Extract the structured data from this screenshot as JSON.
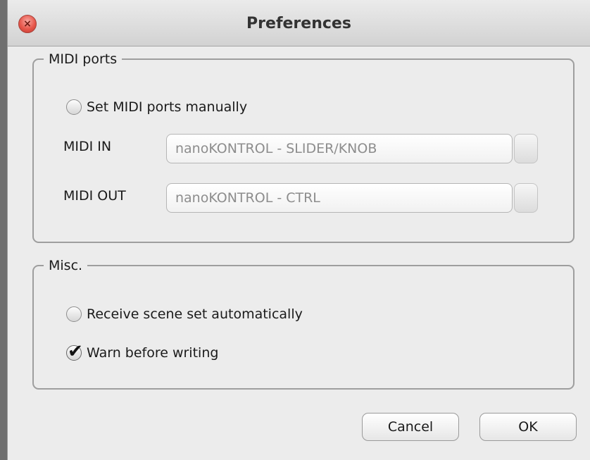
{
  "window": {
    "title": "Preferences",
    "close_icon_glyph": "×"
  },
  "midi_ports": {
    "legend": "MIDI ports",
    "manual_checkbox": {
      "label": "Set MIDI ports manually",
      "checked": false
    },
    "midi_in": {
      "label": "MIDI IN",
      "value": "nanoKONTROL - SLIDER/KNOB"
    },
    "midi_out": {
      "label": "MIDI OUT",
      "value": "nanoKONTROL - CTRL"
    }
  },
  "misc": {
    "legend": "Misc.",
    "receive_scene_checkbox": {
      "label": "Receive scene set automatically",
      "checked": false
    },
    "warn_checkbox": {
      "label": "Warn before writing",
      "checked": true
    },
    "check_glyph": "✔"
  },
  "buttons": {
    "cancel": "Cancel",
    "ok": "OK"
  },
  "colors": {
    "close_button": "#e7574b",
    "window_background": "#ececec",
    "disabled_text": "#8d8d8d"
  }
}
